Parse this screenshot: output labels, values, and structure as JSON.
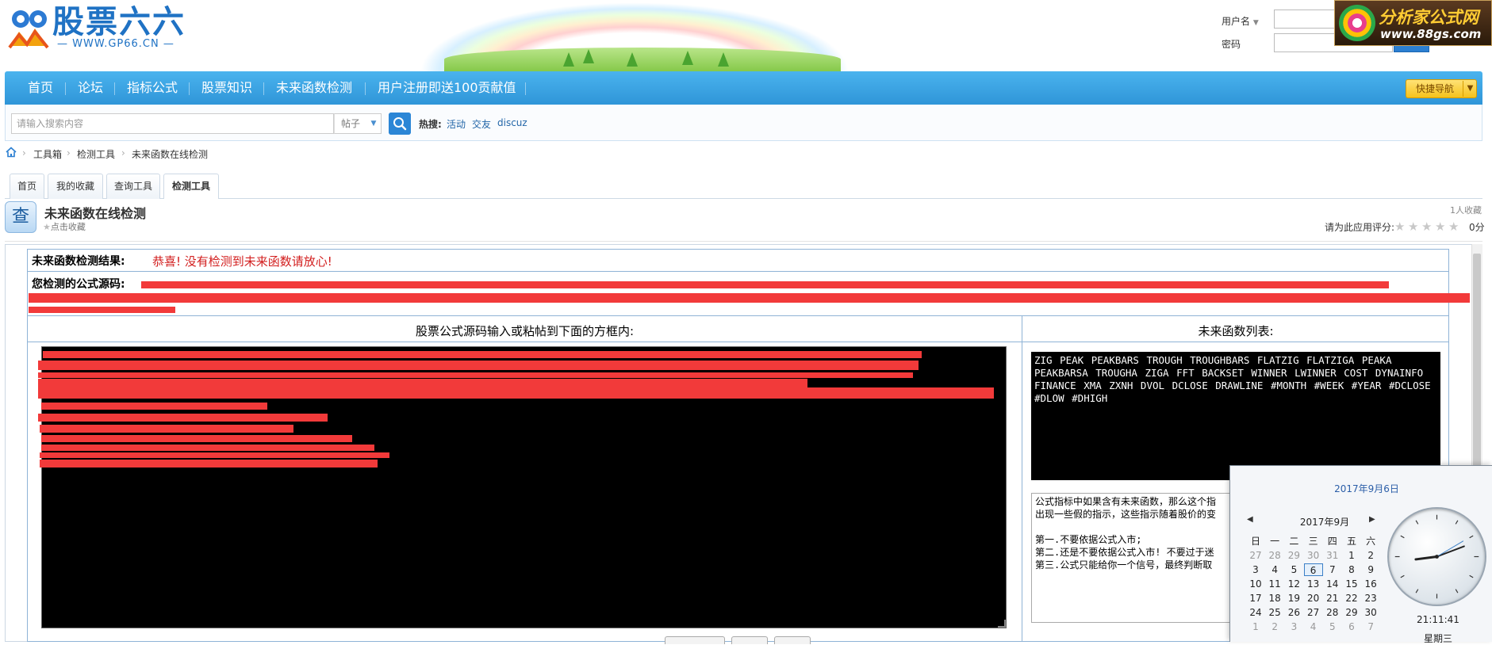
{
  "site": {
    "logo_text": "股票六六",
    "logo_url": "— WWW.GP66.CN —"
  },
  "login": {
    "username_label": "用户名",
    "password_label": "密码"
  },
  "ad": {
    "title": "分析家公式网",
    "url": "www.88gs.com"
  },
  "nav": {
    "items": [
      "首页",
      "论坛",
      "指标公式",
      "股票知识",
      "未来函数检测",
      "用户注册即送100贡献值"
    ],
    "quick_nav": "快捷导航"
  },
  "search": {
    "placeholder": "请输入搜索内容",
    "type": "帖子",
    "hot_label": "热搜:",
    "hot_links": [
      "活动",
      "交友",
      "discuz"
    ]
  },
  "breadcrumb": [
    "工具箱",
    "检测工具",
    "未来函数在线检测"
  ],
  "tabs": [
    "首页",
    "我的收藏",
    "查询工具",
    "检测工具"
  ],
  "app": {
    "icon_char": "查",
    "title": "未来函数在线检测",
    "favorite_label": "点击收藏",
    "favorite_count": "1人收藏",
    "rate_label": "请为此应用评分:",
    "rate_score": "0分",
    "rating_value": 0,
    "rating_max": 5
  },
  "result": {
    "label": "未来函数检测结果:",
    "message": "恭喜! 没有检测到未来函数请放心!",
    "source_label": "您检测的公式源码:"
  },
  "columns": {
    "left_title": "股票公式源码输入或粘帖到下面的方框内:",
    "right_title": "未来函数列表:"
  },
  "future_functions": "ZIG PEAK PEAKBARS TROUGH TROUGHBARS FLATZIG FLATZIGA PEAKA PEAKBARSA TROUGHA ZIGA FFT BACKSET WINNER LWINNER COST DYNAINFO FINANCE XMA ZXNH DVOL DCLOSE DRAWLINE #MONTH #WEEK #YEAR #DCLOSE #DLOW #DHIGH",
  "note": {
    "lines": [
      "公式指标中如果含有未来函数，那么这个指",
      "出现一些假的指示，这些指示随着股价的变",
      "",
      "第一.不要依据公式入市;",
      "第二.还是不要依据公式入市! 不要过于迷",
      "第三.公式只能给你一个信号，最终判断取"
    ]
  },
  "calendar": {
    "header_date": "2017年9月6日",
    "month_label": "2017年9月",
    "weekdays": [
      "日",
      "一",
      "二",
      "三",
      "四",
      "五",
      "六"
    ],
    "days": [
      [
        "27",
        "28",
        "29",
        "30",
        "31",
        "1",
        "2"
      ],
      [
        "3",
        "4",
        "5",
        "6",
        "7",
        "8",
        "9"
      ],
      [
        "10",
        "11",
        "12",
        "13",
        "14",
        "15",
        "16"
      ],
      [
        "17",
        "18",
        "19",
        "20",
        "21",
        "22",
        "23"
      ],
      [
        "24",
        "25",
        "26",
        "27",
        "28",
        "29",
        "30"
      ],
      [
        "1",
        "2",
        "3",
        "4",
        "5",
        "6",
        "7"
      ]
    ],
    "selected_day": "6",
    "time": "21:11:41",
    "weekday_label": "星期三"
  },
  "colors": {
    "nav_blue": "#3aa4e3",
    "result_red": "#d21d1d",
    "redaction": "#f23a3a",
    "quick_nav_yellow": "#f5c21c"
  }
}
